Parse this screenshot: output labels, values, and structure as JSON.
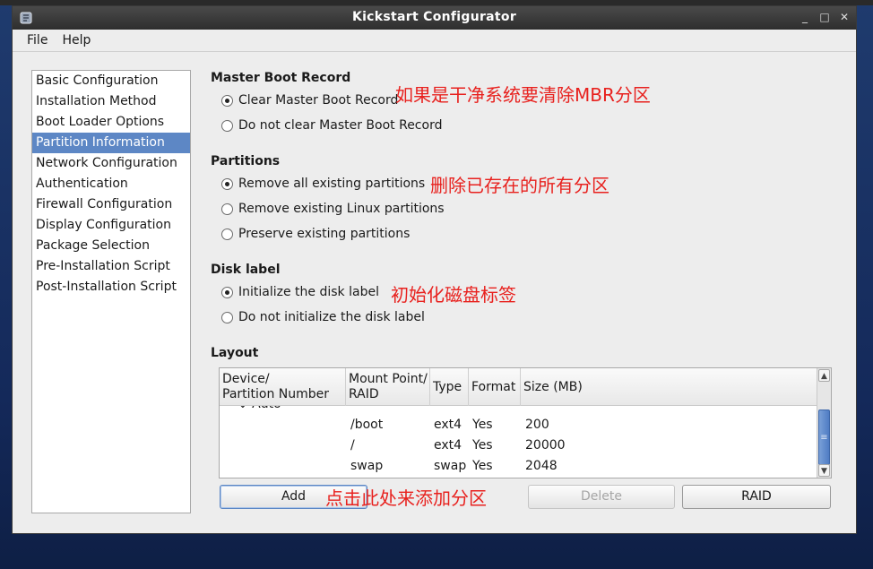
{
  "window": {
    "title": "Kickstart Configurator",
    "controls": {
      "minimize": "_",
      "maximize": "□",
      "close": "✕"
    }
  },
  "menu": [
    "File",
    "Help"
  ],
  "sidebar": {
    "items": [
      "Basic Configuration",
      "Installation Method",
      "Boot Loader Options",
      "Partition Information",
      "Network Configuration",
      "Authentication",
      "Firewall Configuration",
      "Display Configuration",
      "Package Selection",
      "Pre-Installation Script",
      "Post-Installation Script"
    ],
    "selected": "Partition Information"
  },
  "mbr": {
    "title": "Master Boot Record",
    "options": [
      "Clear Master Boot Record",
      "Do not clear Master Boot Record"
    ],
    "selected": 0,
    "note": "如果是干净系统要清除MBR分区"
  },
  "partitions": {
    "title": "Partitions",
    "options": [
      "Remove all existing partitions",
      "Remove existing Linux partitions",
      "Preserve existing partitions"
    ],
    "selected": 0,
    "note": "删除已存在的所有分区"
  },
  "disklabel": {
    "title": "Disk label",
    "options": [
      "Initialize the disk label",
      "Do not initialize the disk label"
    ],
    "selected": 0,
    "note": "初始化磁盘标签"
  },
  "layout": {
    "title": "Layout",
    "columns": [
      "Device/\nPartition Number",
      "Mount Point/\nRAID",
      "Type",
      "Format",
      "Size (MB)"
    ],
    "partial_row": "⌄ Auto",
    "rows": [
      {
        "mount": "/boot",
        "type": "ext4",
        "format": "Yes",
        "size": "200"
      },
      {
        "mount": "/",
        "type": "ext4",
        "format": "Yes",
        "size": "20000"
      },
      {
        "mount": "swap",
        "type": "swap",
        "format": "Yes",
        "size": "2048"
      }
    ]
  },
  "buttons": {
    "add": "Add",
    "edit": "",
    "delete": "Delete",
    "raid": "RAID",
    "note": "点击此处来添加分区"
  },
  "colors": {
    "selection": "#5d87c5",
    "note": "#e8211e",
    "title_bar": "#2e2e2e"
  }
}
